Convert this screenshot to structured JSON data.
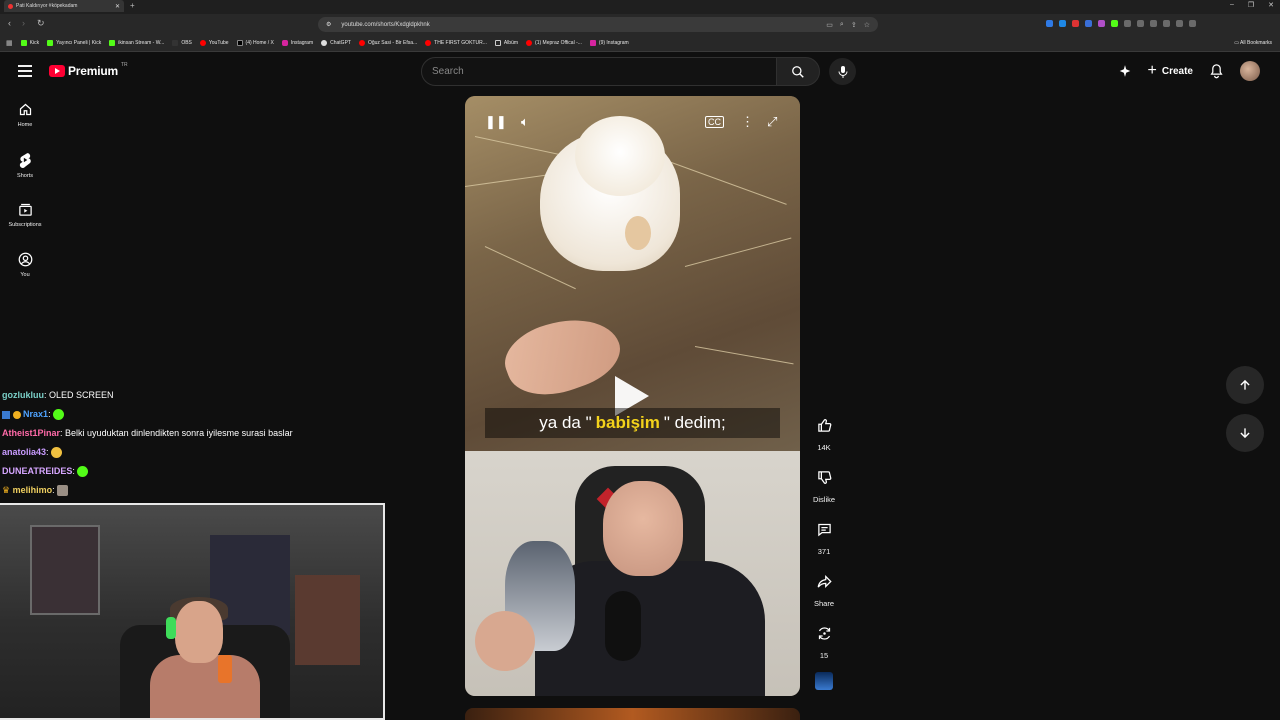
{
  "browser": {
    "tab_title": "Pati Kaldırıyor #köpekadam",
    "url": "youtube.com/shorts/Kxdgldpkhnk",
    "bookmarks": [
      "Kick",
      "Yayıncı Paneli | Kick",
      "ikinsan Stream - W...",
      "OBS",
      "YouTube",
      "(4) Home / X",
      "Instagram",
      "ChatGPT",
      "Oğuz Sasi - Bir Efsa...",
      "THE FIRST GOKTUR...",
      "Albüm",
      "(1) Mepraz Offical -...",
      "(9) Instagram"
    ],
    "all_bookmarks": "All Bookmarks"
  },
  "masthead": {
    "logo_text": "Premium",
    "country": "TR",
    "search_placeholder": "Search",
    "create_label": "Create"
  },
  "sidebar": {
    "items": [
      {
        "label": "Home",
        "icon": "home-icon"
      },
      {
        "label": "Shorts",
        "icon": "shorts-icon"
      },
      {
        "label": "Subscriptions",
        "icon": "subscriptions-icon"
      },
      {
        "label": "You",
        "icon": "you-icon"
      }
    ]
  },
  "chat": {
    "messages": [
      {
        "user": "gozlukluu",
        "color": "#7ad0c8",
        "text": "OLED SCREEN"
      },
      {
        "user": "Nrax1",
        "color": "#4fa3ff",
        "text": ""
      },
      {
        "user": "Atheist1Pinar",
        "color": "#ff6aa8",
        "text": "Belki uyuduktan dinlendikten sonra iyilesme surasi baslar"
      },
      {
        "user": "anatolia43",
        "color": "#c99cff",
        "text": ""
      },
      {
        "user": "DUNEATREIDES",
        "color": "#d6a6ff",
        "text": ""
      },
      {
        "user": "melihimo",
        "color": "#f0d060",
        "text": ""
      }
    ]
  },
  "player": {
    "subtitle_pre": "ya da \"",
    "subtitle_highlight": "babişim",
    "subtitle_post": "\" dedim;"
  },
  "actions": {
    "like_count": "14K",
    "dislike_label": "Dislike",
    "comment_count": "371",
    "share_label": "Share",
    "remix_count": "15"
  }
}
